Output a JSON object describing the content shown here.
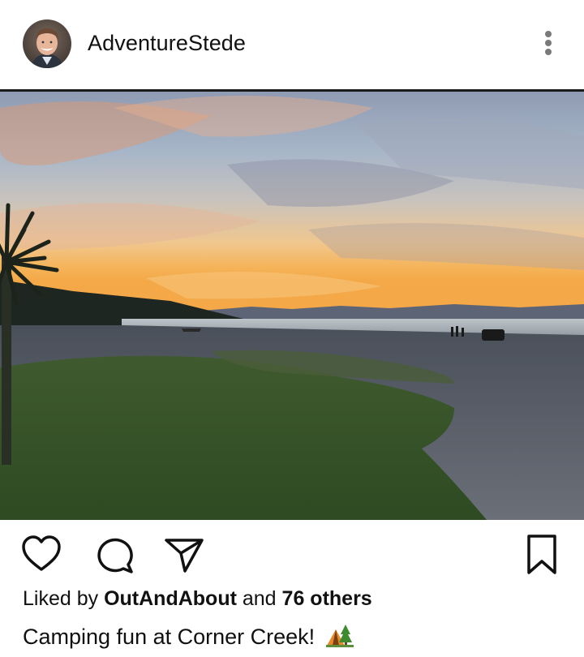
{
  "post": {
    "username": "AdventureStede",
    "likes": {
      "prefix": "Liked by",
      "liker": "OutAndAbout",
      "joiner": "and",
      "others": "76 others"
    },
    "caption": "Camping fun at Corner Creek!",
    "caption_emoji": "camping-tent-emoji"
  },
  "icons": {
    "more": "vertical-ellipsis-icon",
    "like": "heart-outline-icon",
    "comment": "speech-bubble-icon",
    "share": "paper-plane-icon",
    "save": "bookmark-outline-icon"
  }
}
